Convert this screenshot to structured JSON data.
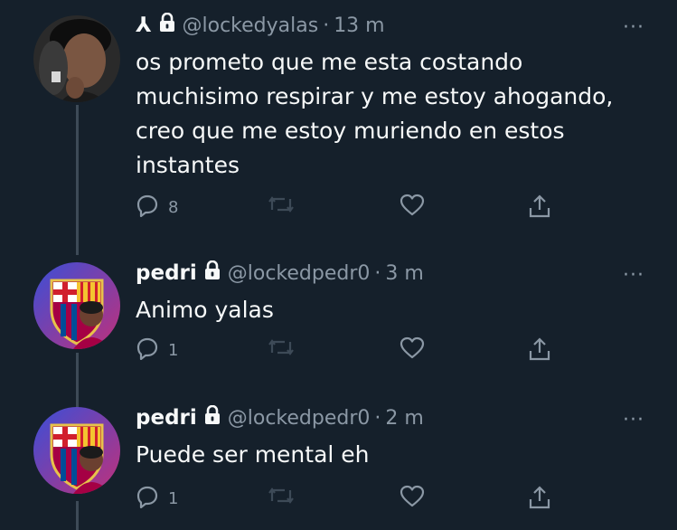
{
  "tweets": [
    {
      "display_name": "⅄",
      "handle": "@lockedyalas",
      "separator": "·",
      "time": "13 m",
      "more": "···",
      "text": "os prometo que me esta costando muchisimo respirar y me estoy ahogando, creo que me estoy muriendo en estos instantes",
      "replies": "8"
    },
    {
      "display_name": "pedri",
      "handle": "@lockedpedr0",
      "separator": "·",
      "time": "3 m",
      "more": "···",
      "text": "Animo yalas",
      "replies": "1"
    },
    {
      "display_name": "pedri",
      "handle": "@lockedpedr0",
      "separator": "·",
      "time": "2 m",
      "more": "···",
      "text": "Puede ser mental eh",
      "replies": "1"
    }
  ],
  "icons": {
    "lock": "lock-icon",
    "reply": "reply-icon",
    "retweet": "retweet-icon",
    "like": "heart-icon",
    "share": "share-icon",
    "more": "more-icon"
  },
  "colors": {
    "background": "#15202b",
    "text": "#f7f9f9",
    "muted": "#8b98a5",
    "thread_line": "#3d4a57"
  }
}
